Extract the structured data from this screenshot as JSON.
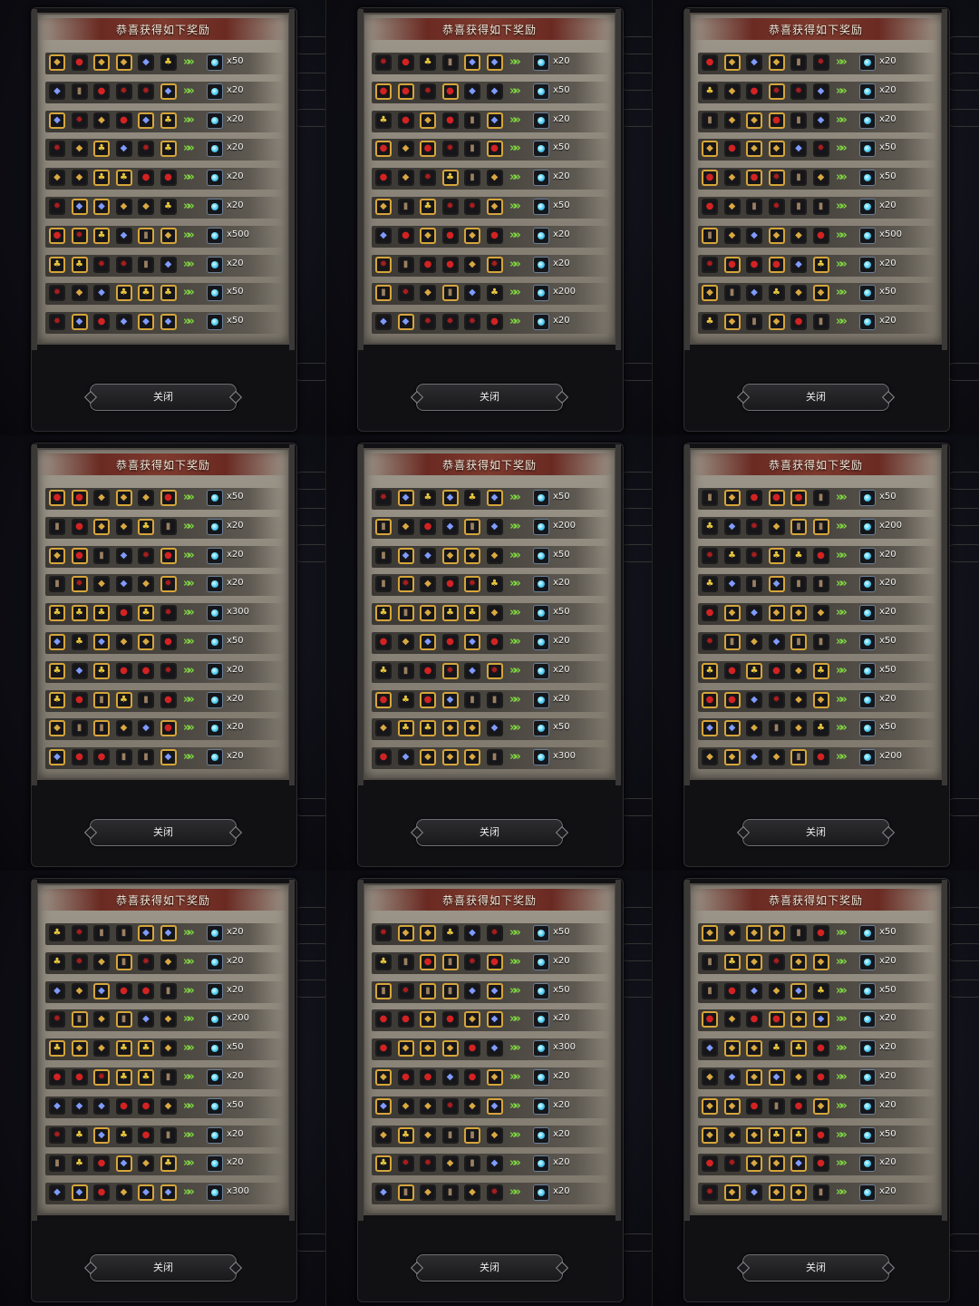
{
  "title": "恭喜获得如下奖励",
  "close_label": "关闭",
  "arrow_glyph": "»",
  "icons": {
    "F": {
      "name": "blood-drop-icon",
      "glyph": "●",
      "cls": "ic-blood"
    },
    "R": {
      "name": "red-seal-icon",
      "glyph": "✹",
      "cls": "ic-seal"
    },
    "G": {
      "name": "gold-ore-icon",
      "glyph": "◆",
      "cls": "ic-ore"
    },
    "N": {
      "name": "gold-nugget-icon",
      "glyph": "♣",
      "cls": "ic-gold"
    },
    "D": {
      "name": "blue-diamond-icon",
      "glyph": "◆",
      "cls": "ic-diamond"
    },
    "B": {
      "name": "barrel-icon",
      "glyph": "▮",
      "cls": "ic-barrel"
    }
  },
  "reward_icon": "blue-crystal-icon",
  "colors": {
    "parchment": "#8f887c",
    "gold_frame": "#d6a53a",
    "arrow": "#7fd640",
    "banner": "#7e3a2e"
  },
  "panels": [
    {
      "rows": [
        {
          "items": [
            "Gg",
            "Fn",
            "Gg",
            "Gg",
            "Dn",
            "Nn"
          ],
          "amount": "x50"
        },
        {
          "items": [
            "Dn",
            "Bn",
            "Fn",
            "Rn",
            "Rn",
            "Dg"
          ],
          "amount": "x20"
        },
        {
          "items": [
            "Dg",
            "Rn",
            "Gn",
            "Fn",
            "Dg",
            "Ng"
          ],
          "amount": "x20"
        },
        {
          "items": [
            "Rn",
            "Gn",
            "Ng",
            "Dn",
            "Rn",
            "Ng"
          ],
          "amount": "x20"
        },
        {
          "items": [
            "Gn",
            "Gn",
            "Ng",
            "Ng",
            "Fn",
            "Fn"
          ],
          "amount": "x20"
        },
        {
          "items": [
            "Rn",
            "Dg",
            "Dg",
            "Gn",
            "Gn",
            "Nn"
          ],
          "amount": "x20"
        },
        {
          "items": [
            "Fg",
            "Rg",
            "Ng",
            "Dn",
            "Bg",
            "Gg"
          ],
          "amount": "x500"
        },
        {
          "items": [
            "Ng",
            "Ng",
            "Rn",
            "Rn",
            "Bn",
            "Dn"
          ],
          "amount": "x20"
        },
        {
          "items": [
            "Rn",
            "Gn",
            "Dn",
            "Ng",
            "Ng",
            "Ng"
          ],
          "amount": "x50"
        },
        {
          "items": [
            "Rn",
            "Dg",
            "Fn",
            "Dn",
            "Dg",
            "Dg"
          ],
          "amount": "x50"
        }
      ]
    },
    {
      "rows": [
        {
          "items": [
            "Rn",
            "Fn",
            "Nn",
            "Bn",
            "Dg",
            "Dg"
          ],
          "amount": "x20"
        },
        {
          "items": [
            "Fg",
            "Fg",
            "Rn",
            "Fg",
            "Dn",
            "Dn"
          ],
          "amount": "x50"
        },
        {
          "items": [
            "Nn",
            "Fn",
            "Gg",
            "Fn",
            "Bn",
            "Dg"
          ],
          "amount": "x20"
        },
        {
          "items": [
            "Fg",
            "Gn",
            "Fg",
            "Rn",
            "Bn",
            "Fg"
          ],
          "amount": "x50"
        },
        {
          "items": [
            "Fn",
            "Gn",
            "Rn",
            "Ng",
            "Bn",
            "Gn"
          ],
          "amount": "x20"
        },
        {
          "items": [
            "Gg",
            "Bn",
            "Ng",
            "Rn",
            "Rn",
            "Gg"
          ],
          "amount": "x50"
        },
        {
          "items": [
            "Dn",
            "Fn",
            "Gg",
            "Fn",
            "Gg",
            "Fn"
          ],
          "amount": "x20"
        },
        {
          "items": [
            "Rg",
            "Bn",
            "Fn",
            "Fn",
            "Gn",
            "Rg"
          ],
          "amount": "x20"
        },
        {
          "items": [
            "Bg",
            "Rn",
            "Gn",
            "Bg",
            "Dn",
            "Nn"
          ],
          "amount": "x200"
        },
        {
          "items": [
            "Dn",
            "Dg",
            "Rn",
            "Rn",
            "Rn",
            "Fn"
          ],
          "amount": "x20"
        }
      ]
    },
    {
      "rows": [
        {
          "items": [
            "Fn",
            "Gg",
            "Dn",
            "Gg",
            "Bn",
            "Rn"
          ],
          "amount": "x20"
        },
        {
          "items": [
            "Nn",
            "Gn",
            "Fn",
            "Rg",
            "Rn",
            "Dn"
          ],
          "amount": "x20"
        },
        {
          "items": [
            "Bn",
            "Gn",
            "Gg",
            "Fg",
            "Bn",
            "Dn"
          ],
          "amount": "x20"
        },
        {
          "items": [
            "Gg",
            "Fn",
            "Gg",
            "Gg",
            "Dn",
            "Rn"
          ],
          "amount": "x50"
        },
        {
          "items": [
            "Fg",
            "Gn",
            "Fg",
            "Rg",
            "Bn",
            "Gn"
          ],
          "amount": "x50"
        },
        {
          "items": [
            "Fn",
            "Gn",
            "Bn",
            "Rn",
            "Bn",
            "Bn"
          ],
          "amount": "x20"
        },
        {
          "items": [
            "Bg",
            "Gn",
            "Dn",
            "Gg",
            "Gn",
            "Fn"
          ],
          "amount": "x500"
        },
        {
          "items": [
            "Rn",
            "Fg",
            "Fn",
            "Fg",
            "Dn",
            "Ng"
          ],
          "amount": "x20"
        },
        {
          "items": [
            "Gg",
            "Bn",
            "Dn",
            "Nn",
            "Gn",
            "Gg"
          ],
          "amount": "x50"
        },
        {
          "items": [
            "Nn",
            "Gg",
            "Bn",
            "Gg",
            "Fn",
            "Bn"
          ],
          "amount": "x20"
        }
      ]
    },
    {
      "rows": [
        {
          "items": [
            "Fg",
            "Fg",
            "Gn",
            "Gg",
            "Gn",
            "Fg"
          ],
          "amount": "x50"
        },
        {
          "items": [
            "Bn",
            "Fn",
            "Gg",
            "Gn",
            "Ng",
            "Bn"
          ],
          "amount": "x20"
        },
        {
          "items": [
            "Gg",
            "Fg",
            "Bn",
            "Dn",
            "Rn",
            "Fg"
          ],
          "amount": "x20"
        },
        {
          "items": [
            "Bn",
            "Rg",
            "Gn",
            "Dn",
            "Gn",
            "Rg"
          ],
          "amount": "x20"
        },
        {
          "items": [
            "Ng",
            "Ng",
            "Ng",
            "Fn",
            "Ng",
            "Rn"
          ],
          "amount": "x300"
        },
        {
          "items": [
            "Dg",
            "Nn",
            "Dg",
            "Gn",
            "Gg",
            "Fn"
          ],
          "amount": "x50"
        },
        {
          "items": [
            "Ng",
            "Dn",
            "Ng",
            "Fn",
            "Fn",
            "Rn"
          ],
          "amount": "x20"
        },
        {
          "items": [
            "Ng",
            "Fn",
            "Bg",
            "Ng",
            "Bn",
            "Fn"
          ],
          "amount": "x20"
        },
        {
          "items": [
            "Gg",
            "Bn",
            "Bg",
            "Gn",
            "Dn",
            "Fg"
          ],
          "amount": "x20"
        },
        {
          "items": [
            "Dg",
            "Fn",
            "Fn",
            "Bn",
            "Bn",
            "Dg"
          ],
          "amount": "x20"
        }
      ]
    },
    {
      "rows": [
        {
          "items": [
            "Rn",
            "Dg",
            "Nn",
            "Dg",
            "Nn",
            "Dg"
          ],
          "amount": "x50"
        },
        {
          "items": [
            "Bg",
            "Gn",
            "Fn",
            "Dn",
            "Bg",
            "Dn"
          ],
          "amount": "x200"
        },
        {
          "items": [
            "Bn",
            "Dg",
            "Dn",
            "Gg",
            "Gg",
            "Gn"
          ],
          "amount": "x50"
        },
        {
          "items": [
            "Bn",
            "Rg",
            "Gn",
            "Fn",
            "Rg",
            "Nn"
          ],
          "amount": "x20"
        },
        {
          "items": [
            "Ng",
            "Bg",
            "Gg",
            "Ng",
            "Ng",
            "Gn"
          ],
          "amount": "x50"
        },
        {
          "items": [
            "Fn",
            "Gn",
            "Dg",
            "Fn",
            "Dg",
            "Fn"
          ],
          "amount": "x20"
        },
        {
          "items": [
            "Nn",
            "Bn",
            "Fn",
            "Rg",
            "Dn",
            "Rg"
          ],
          "amount": "x20"
        },
        {
          "items": [
            "Fg",
            "Nn",
            "Fg",
            "Dg",
            "Bn",
            "Bn"
          ],
          "amount": "x20"
        },
        {
          "items": [
            "Gn",
            "Ng",
            "Ng",
            "Gg",
            "Gg",
            "Dn"
          ],
          "amount": "x50"
        },
        {
          "items": [
            "Fn",
            "Dn",
            "Gg",
            "Gg",
            "Gg",
            "Bn"
          ],
          "amount": "x300"
        }
      ]
    },
    {
      "rows": [
        {
          "items": [
            "Bn",
            "Gg",
            "Fn",
            "Fg",
            "Fg",
            "Bn"
          ],
          "amount": "x50"
        },
        {
          "items": [
            "Nn",
            "Dn",
            "Rn",
            "Gn",
            "Bg",
            "Bg"
          ],
          "amount": "x200"
        },
        {
          "items": [
            "Rn",
            "Nn",
            "Rn",
            "Ng",
            "Nn",
            "Fn"
          ],
          "amount": "x20"
        },
        {
          "items": [
            "Nn",
            "Dn",
            "Bn",
            "Dg",
            "Bn",
            "Bn"
          ],
          "amount": "x20"
        },
        {
          "items": [
            "Fn",
            "Gg",
            "Dn",
            "Gg",
            "Gg",
            "Gn"
          ],
          "amount": "x20"
        },
        {
          "items": [
            "Rn",
            "Bg",
            "Gn",
            "Dn",
            "Bg",
            "Bn"
          ],
          "amount": "x50"
        },
        {
          "items": [
            "Ng",
            "Fn",
            "Ng",
            "Fn",
            "Gn",
            "Ng"
          ],
          "amount": "x50"
        },
        {
          "items": [
            "Fg",
            "Fg",
            "Dn",
            "Rn",
            "Gn",
            "Gg"
          ],
          "amount": "x20"
        },
        {
          "items": [
            "Dg",
            "Dg",
            "Gn",
            "Bn",
            "Gn",
            "Nn"
          ],
          "amount": "x50"
        },
        {
          "items": [
            "Gn",
            "Gg",
            "Dn",
            "Gn",
            "Bg",
            "Fn"
          ],
          "amount": "x200"
        }
      ]
    },
    {
      "rows": [
        {
          "items": [
            "Nn",
            "Rn",
            "Bn",
            "Bn",
            "Dg",
            "Dg"
          ],
          "amount": "x20"
        },
        {
          "items": [
            "Nn",
            "Rn",
            "Gn",
            "Bg",
            "Rn",
            "Gn"
          ],
          "amount": "x20"
        },
        {
          "items": [
            "Dn",
            "Gn",
            "Dg",
            "Fn",
            "Fn",
            "Bn"
          ],
          "amount": "x20"
        },
        {
          "items": [
            "Rn",
            "Bg",
            "Gn",
            "Bg",
            "Dn",
            "Gn"
          ],
          "amount": "x200"
        },
        {
          "items": [
            "Ng",
            "Gg",
            "Gn",
            "Ng",
            "Ng",
            "Gn"
          ],
          "amount": "x50"
        },
        {
          "items": [
            "Fn",
            "Fn",
            "Rg",
            "Ng",
            "Ng",
            "Bn"
          ],
          "amount": "x20"
        },
        {
          "items": [
            "Dn",
            "Dn",
            "Dn",
            "Fn",
            "Fn",
            "Gn"
          ],
          "amount": "x50"
        },
        {
          "items": [
            "Rn",
            "Nn",
            "Dg",
            "Nn",
            "Fn",
            "Bn"
          ],
          "amount": "x20"
        },
        {
          "items": [
            "Bn",
            "Nn",
            "Fn",
            "Dg",
            "Gn",
            "Ng"
          ],
          "amount": "x20"
        },
        {
          "items": [
            "Dn",
            "Dg",
            "Fn",
            "Gn",
            "Dg",
            "Dg"
          ],
          "amount": "x300"
        }
      ]
    },
    {
      "rows": [
        {
          "items": [
            "Rn",
            "Gg",
            "Gg",
            "Nn",
            "Dn",
            "Rn"
          ],
          "amount": "x50"
        },
        {
          "items": [
            "Nn",
            "Bn",
            "Fg",
            "Bg",
            "Rn",
            "Fg"
          ],
          "amount": "x20"
        },
        {
          "items": [
            "Bg",
            "Rn",
            "Bg",
            "Bg",
            "Dn",
            "Dg"
          ],
          "amount": "x50"
        },
        {
          "items": [
            "Fn",
            "Fn",
            "Gg",
            "Fn",
            "Gg",
            "Dg"
          ],
          "amount": "x20"
        },
        {
          "items": [
            "Fn",
            "Gg",
            "Gg",
            "Gg",
            "Fn",
            "Dn"
          ],
          "amount": "x300"
        },
        {
          "items": [
            "Gg",
            "Fn",
            "Fn",
            "Dn",
            "Fn",
            "Gg"
          ],
          "amount": "x20"
        },
        {
          "items": [
            "Dg",
            "Gn",
            "Gn",
            "Rn",
            "Gn",
            "Dg"
          ],
          "amount": "x20"
        },
        {
          "items": [
            "Gn",
            "Ng",
            "Gn",
            "Bn",
            "Bg",
            "Gn"
          ],
          "amount": "x20"
        },
        {
          "items": [
            "Ng",
            "Rn",
            "Rn",
            "Gn",
            "Bn",
            "Dn"
          ],
          "amount": "x20"
        },
        {
          "items": [
            "Dn",
            "Bg",
            "Gn",
            "Bn",
            "Gn",
            "Rn"
          ],
          "amount": "x20"
        }
      ]
    },
    {
      "rows": [
        {
          "items": [
            "Gg",
            "Gn",
            "Gg",
            "Gg",
            "Bn",
            "Fn"
          ],
          "amount": "x50"
        },
        {
          "items": [
            "Bn",
            "Ng",
            "Gg",
            "Rn",
            "Gg",
            "Gg"
          ],
          "amount": "x20"
        },
        {
          "items": [
            "Bn",
            "Fn",
            "Dn",
            "Gn",
            "Dg",
            "Nn"
          ],
          "amount": "x50"
        },
        {
          "items": [
            "Fg",
            "Gn",
            "Fn",
            "Fg",
            "Gg",
            "Dg"
          ],
          "amount": "x20"
        },
        {
          "items": [
            "Dn",
            "Gg",
            "Gg",
            "Nn",
            "Ng",
            "Fn"
          ],
          "amount": "x20"
        },
        {
          "items": [
            "Gn",
            "Dn",
            "Gg",
            "Dg",
            "Gn",
            "Fn"
          ],
          "amount": "x20"
        },
        {
          "items": [
            "Gg",
            "Gg",
            "Fn",
            "Bn",
            "Fn",
            "Gg"
          ],
          "amount": "x20"
        },
        {
          "items": [
            "Gg",
            "Gn",
            "Gg",
            "Ng",
            "Ng",
            "Fn"
          ],
          "amount": "x50"
        },
        {
          "items": [
            "Fn",
            "Rn",
            "Gg",
            "Gg",
            "Dg",
            "Fn"
          ],
          "amount": "x20"
        },
        {
          "items": [
            "Rn",
            "Gg",
            "Dn",
            "Gg",
            "Gg",
            "Bn"
          ],
          "amount": "x20"
        }
      ]
    }
  ]
}
